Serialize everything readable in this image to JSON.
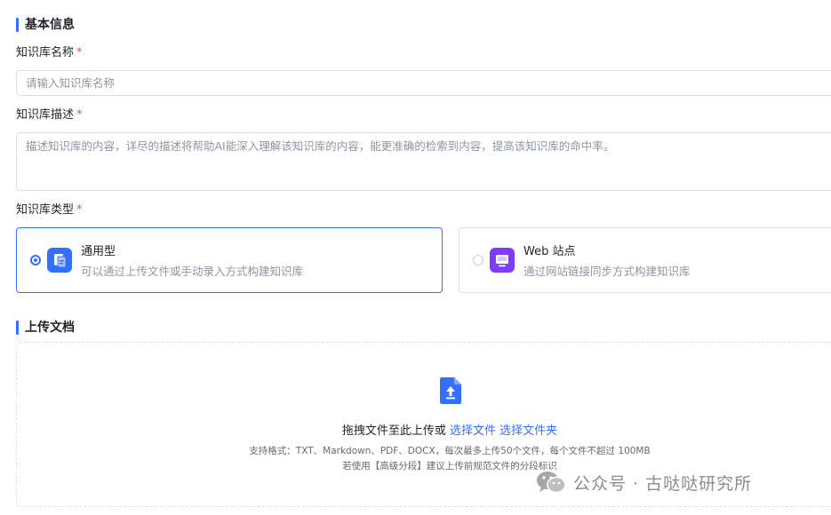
{
  "basic_info": {
    "section_title": "基本信息",
    "name": {
      "label": "知识库名称",
      "required_mark": "*",
      "value": "",
      "placeholder": "请输入知识库名称"
    },
    "description": {
      "label": "知识库描述",
      "required_mark": "*",
      "value": "",
      "placeholder": "描述知识库的内容，详尽的描述将帮助AI能深入理解该知识库的内容，能更准确的检索到内容，提高该知识库的命中率。"
    },
    "type": {
      "label": "知识库类型",
      "required_mark": "*",
      "options": [
        {
          "title": "通用型",
          "description": "可以通过上传文件或手动录入方式构建知识库",
          "icon": "document-icon",
          "icon_color": "#3370ff",
          "selected": true
        },
        {
          "title": "Web 站点",
          "description": "通过网站链接同步方式构建知识库",
          "icon": "monitor-icon",
          "icon_color": "#7f3bf5",
          "selected": false
        }
      ]
    }
  },
  "upload": {
    "section_title": "上传文档",
    "prompt": "拖拽文件至此上传或",
    "select_file": "选择文件",
    "select_folder": "选择文件夹",
    "formats_hint": "支持格式：TXT、Markdown、PDF、DOCX，每次最多上传50个文件，每个文件不超过 100MB",
    "advanced_hint": "若使用【高级分段】建议上传前规范文件的分段标识",
    "icon": "file-upload-icon"
  },
  "watermark": {
    "text": "公众号 · 古哒哒研究所",
    "icon": "wechat-icon"
  },
  "colors": {
    "accent": "#3370ff",
    "required": "#f54a45",
    "border": "#dee0e3",
    "muted_text": "#8f959e"
  }
}
